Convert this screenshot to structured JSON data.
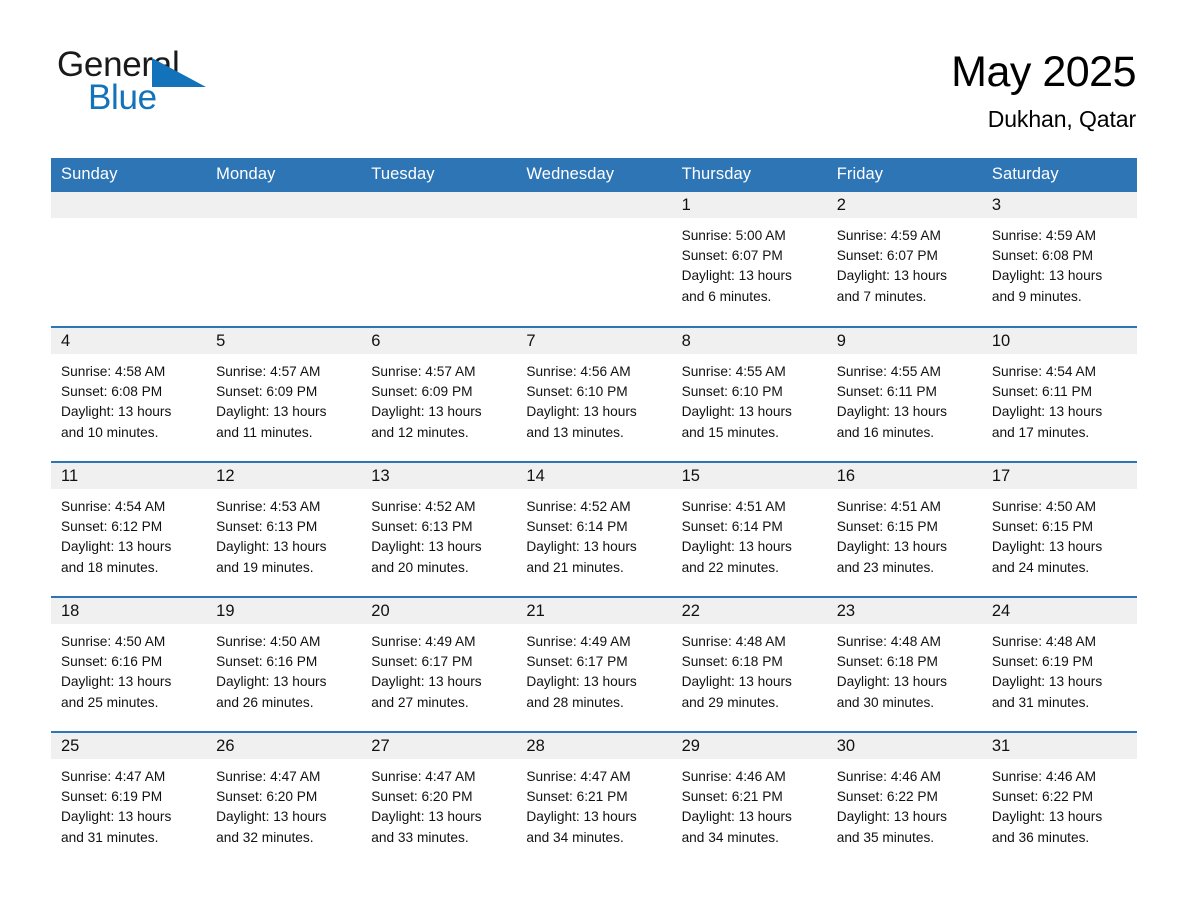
{
  "brand": {
    "name_part1": "General",
    "name_part2": "Blue",
    "triangle_icon": "triangle-icon",
    "accent_color": "#1272ba"
  },
  "header": {
    "month_title": "May 2025",
    "location": "Dukhan, Qatar"
  },
  "calendar": {
    "header_color": "#2e75b6",
    "daynum_band_color": "#f0f0f0",
    "weekdays": [
      "Sunday",
      "Monday",
      "Tuesday",
      "Wednesday",
      "Thursday",
      "Friday",
      "Saturday"
    ],
    "weeks": [
      [
        {
          "day": "",
          "empty": true
        },
        {
          "day": "",
          "empty": true
        },
        {
          "day": "",
          "empty": true
        },
        {
          "day": "",
          "empty": true
        },
        {
          "day": "1",
          "sunrise": "Sunrise: 5:00 AM",
          "sunset": "Sunset: 6:07 PM",
          "daylight1": "Daylight: 13 hours",
          "daylight2": "and 6 minutes."
        },
        {
          "day": "2",
          "sunrise": "Sunrise: 4:59 AM",
          "sunset": "Sunset: 6:07 PM",
          "daylight1": "Daylight: 13 hours",
          "daylight2": "and 7 minutes."
        },
        {
          "day": "3",
          "sunrise": "Sunrise: 4:59 AM",
          "sunset": "Sunset: 6:08 PM",
          "daylight1": "Daylight: 13 hours",
          "daylight2": "and 9 minutes."
        }
      ],
      [
        {
          "day": "4",
          "sunrise": "Sunrise: 4:58 AM",
          "sunset": "Sunset: 6:08 PM",
          "daylight1": "Daylight: 13 hours",
          "daylight2": "and 10 minutes."
        },
        {
          "day": "5",
          "sunrise": "Sunrise: 4:57 AM",
          "sunset": "Sunset: 6:09 PM",
          "daylight1": "Daylight: 13 hours",
          "daylight2": "and 11 minutes."
        },
        {
          "day": "6",
          "sunrise": "Sunrise: 4:57 AM",
          "sunset": "Sunset: 6:09 PM",
          "daylight1": "Daylight: 13 hours",
          "daylight2": "and 12 minutes."
        },
        {
          "day": "7",
          "sunrise": "Sunrise: 4:56 AM",
          "sunset": "Sunset: 6:10 PM",
          "daylight1": "Daylight: 13 hours",
          "daylight2": "and 13 minutes."
        },
        {
          "day": "8",
          "sunrise": "Sunrise: 4:55 AM",
          "sunset": "Sunset: 6:10 PM",
          "daylight1": "Daylight: 13 hours",
          "daylight2": "and 15 minutes."
        },
        {
          "day": "9",
          "sunrise": "Sunrise: 4:55 AM",
          "sunset": "Sunset: 6:11 PM",
          "daylight1": "Daylight: 13 hours",
          "daylight2": "and 16 minutes."
        },
        {
          "day": "10",
          "sunrise": "Sunrise: 4:54 AM",
          "sunset": "Sunset: 6:11 PM",
          "daylight1": "Daylight: 13 hours",
          "daylight2": "and 17 minutes."
        }
      ],
      [
        {
          "day": "11",
          "sunrise": "Sunrise: 4:54 AM",
          "sunset": "Sunset: 6:12 PM",
          "daylight1": "Daylight: 13 hours",
          "daylight2": "and 18 minutes."
        },
        {
          "day": "12",
          "sunrise": "Sunrise: 4:53 AM",
          "sunset": "Sunset: 6:13 PM",
          "daylight1": "Daylight: 13 hours",
          "daylight2": "and 19 minutes."
        },
        {
          "day": "13",
          "sunrise": "Sunrise: 4:52 AM",
          "sunset": "Sunset: 6:13 PM",
          "daylight1": "Daylight: 13 hours",
          "daylight2": "and 20 minutes."
        },
        {
          "day": "14",
          "sunrise": "Sunrise: 4:52 AM",
          "sunset": "Sunset: 6:14 PM",
          "daylight1": "Daylight: 13 hours",
          "daylight2": "and 21 minutes."
        },
        {
          "day": "15",
          "sunrise": "Sunrise: 4:51 AM",
          "sunset": "Sunset: 6:14 PM",
          "daylight1": "Daylight: 13 hours",
          "daylight2": "and 22 minutes."
        },
        {
          "day": "16",
          "sunrise": "Sunrise: 4:51 AM",
          "sunset": "Sunset: 6:15 PM",
          "daylight1": "Daylight: 13 hours",
          "daylight2": "and 23 minutes."
        },
        {
          "day": "17",
          "sunrise": "Sunrise: 4:50 AM",
          "sunset": "Sunset: 6:15 PM",
          "daylight1": "Daylight: 13 hours",
          "daylight2": "and 24 minutes."
        }
      ],
      [
        {
          "day": "18",
          "sunrise": "Sunrise: 4:50 AM",
          "sunset": "Sunset: 6:16 PM",
          "daylight1": "Daylight: 13 hours",
          "daylight2": "and 25 minutes."
        },
        {
          "day": "19",
          "sunrise": "Sunrise: 4:50 AM",
          "sunset": "Sunset: 6:16 PM",
          "daylight1": "Daylight: 13 hours",
          "daylight2": "and 26 minutes."
        },
        {
          "day": "20",
          "sunrise": "Sunrise: 4:49 AM",
          "sunset": "Sunset: 6:17 PM",
          "daylight1": "Daylight: 13 hours",
          "daylight2": "and 27 minutes."
        },
        {
          "day": "21",
          "sunrise": "Sunrise: 4:49 AM",
          "sunset": "Sunset: 6:17 PM",
          "daylight1": "Daylight: 13 hours",
          "daylight2": "and 28 minutes."
        },
        {
          "day": "22",
          "sunrise": "Sunrise: 4:48 AM",
          "sunset": "Sunset: 6:18 PM",
          "daylight1": "Daylight: 13 hours",
          "daylight2": "and 29 minutes."
        },
        {
          "day": "23",
          "sunrise": "Sunrise: 4:48 AM",
          "sunset": "Sunset: 6:18 PM",
          "daylight1": "Daylight: 13 hours",
          "daylight2": "and 30 minutes."
        },
        {
          "day": "24",
          "sunrise": "Sunrise: 4:48 AM",
          "sunset": "Sunset: 6:19 PM",
          "daylight1": "Daylight: 13 hours",
          "daylight2": "and 31 minutes."
        }
      ],
      [
        {
          "day": "25",
          "sunrise": "Sunrise: 4:47 AM",
          "sunset": "Sunset: 6:19 PM",
          "daylight1": "Daylight: 13 hours",
          "daylight2": "and 31 minutes."
        },
        {
          "day": "26",
          "sunrise": "Sunrise: 4:47 AM",
          "sunset": "Sunset: 6:20 PM",
          "daylight1": "Daylight: 13 hours",
          "daylight2": "and 32 minutes."
        },
        {
          "day": "27",
          "sunrise": "Sunrise: 4:47 AM",
          "sunset": "Sunset: 6:20 PM",
          "daylight1": "Daylight: 13 hours",
          "daylight2": "and 33 minutes."
        },
        {
          "day": "28",
          "sunrise": "Sunrise: 4:47 AM",
          "sunset": "Sunset: 6:21 PM",
          "daylight1": "Daylight: 13 hours",
          "daylight2": "and 34 minutes."
        },
        {
          "day": "29",
          "sunrise": "Sunrise: 4:46 AM",
          "sunset": "Sunset: 6:21 PM",
          "daylight1": "Daylight: 13 hours",
          "daylight2": "and 34 minutes."
        },
        {
          "day": "30",
          "sunrise": "Sunrise: 4:46 AM",
          "sunset": "Sunset: 6:22 PM",
          "daylight1": "Daylight: 13 hours",
          "daylight2": "and 35 minutes."
        },
        {
          "day": "31",
          "sunrise": "Sunrise: 4:46 AM",
          "sunset": "Sunset: 6:22 PM",
          "daylight1": "Daylight: 13 hours",
          "daylight2": "and 36 minutes."
        }
      ]
    ]
  }
}
